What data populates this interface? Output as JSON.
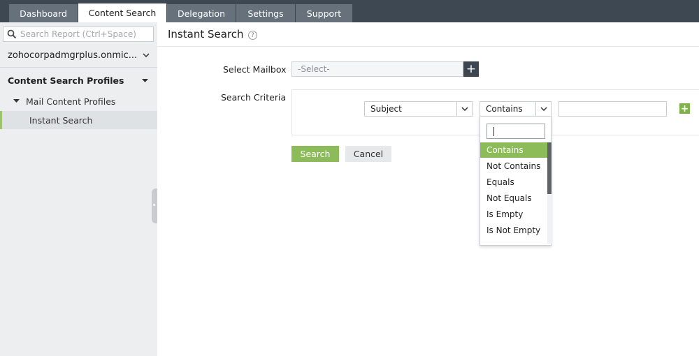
{
  "nav": {
    "tabs": [
      {
        "label": "Dashboard",
        "active": false
      },
      {
        "label": "Content Search",
        "active": true
      },
      {
        "label": "Delegation",
        "active": false
      },
      {
        "label": "Settings",
        "active": false
      },
      {
        "label": "Support",
        "active": false
      }
    ]
  },
  "sidebar": {
    "search_placeholder": "Search Report (Ctrl+Space)",
    "org_name": "zohocorpadmgrplus.onmic...",
    "section_title": "Content Search Profiles",
    "group_label": "Mail Content Profiles",
    "active_item": "Instant Search"
  },
  "main": {
    "title": "Instant Search",
    "help_glyph": "?",
    "mailbox_label": "Select Mailbox",
    "mailbox_placeholder": "-Select-",
    "mailbox_add_glyph": "+",
    "criteria_label": "Search Criteria",
    "field_value": "Subject",
    "operator_value": "Contains",
    "criteria_value": "",
    "add_criteria_glyph": "+",
    "search_label": "Search",
    "cancel_label": "Cancel"
  },
  "dropdown": {
    "search_value": "",
    "options": [
      "Contains",
      "Not Contains",
      "Equals",
      "Not Equals",
      "Is Empty",
      "Is Not Empty"
    ],
    "selected": "Contains"
  },
  "colors": {
    "topbar": "#3e4852",
    "accent_green": "#8cbb5a",
    "sidebar_bg": "#eceef0"
  }
}
